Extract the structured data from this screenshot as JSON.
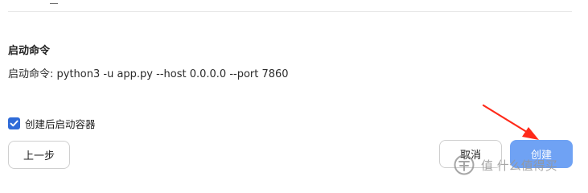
{
  "startup_section": {
    "title": "启动命令",
    "command_line": "启动命令: python3 -u app.py --host 0.0.0.0 --port 7860"
  },
  "options": {
    "start_after_create": {
      "label": "创建后启动容器",
      "checked": true
    }
  },
  "buttons": {
    "previous": "上一步",
    "cancel": "取消",
    "create": "创建"
  },
  "watermark": {
    "text": "值 什么值得买"
  },
  "colors": {
    "accent": "#2f6bd8",
    "primary_button": "#6fa2f4",
    "annotation_arrow": "#ff2a1a"
  }
}
